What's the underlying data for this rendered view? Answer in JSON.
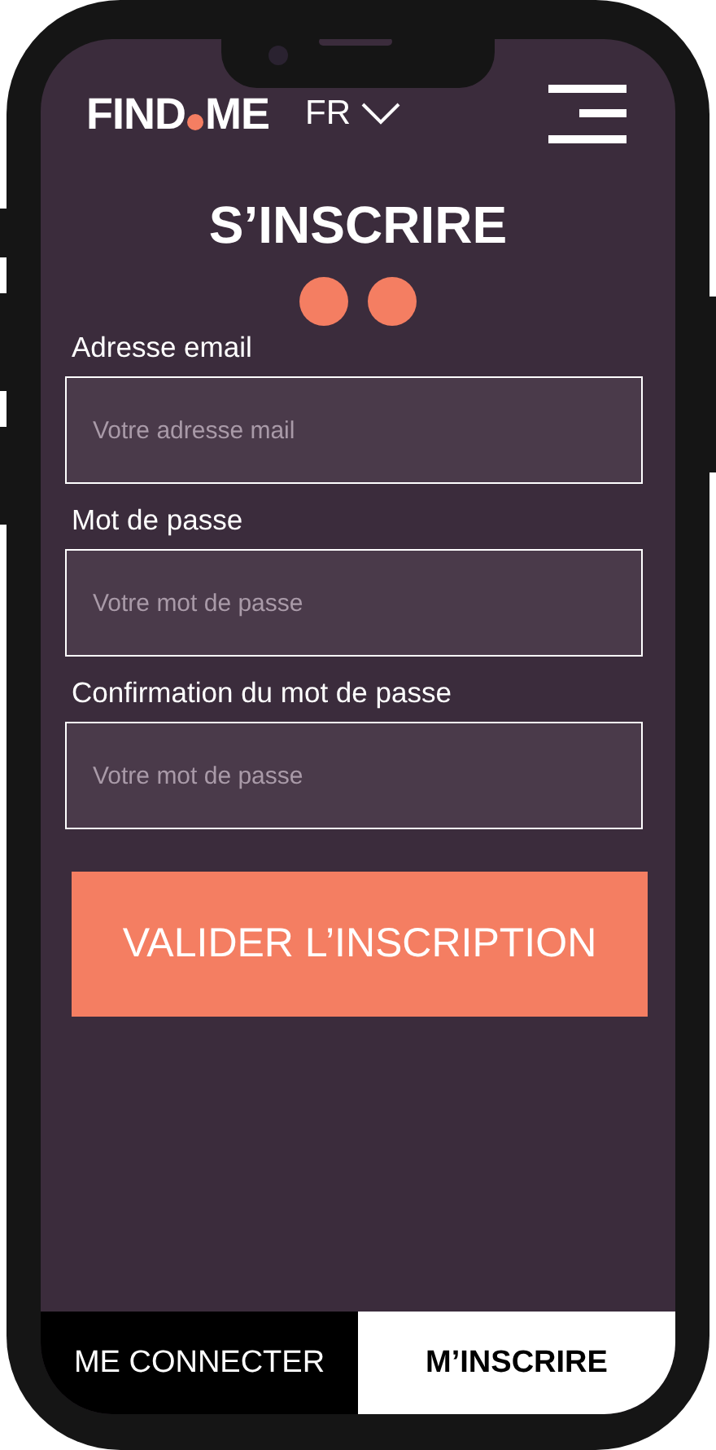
{
  "header": {
    "logo": {
      "left": "FIND",
      "right": "ME"
    },
    "language": "FR"
  },
  "title": "S’INSCRIRE",
  "fields": [
    {
      "label": "Adresse email",
      "placeholder": "Votre adresse mail"
    },
    {
      "label": "Mot de passe",
      "placeholder": "Votre mot de passe"
    },
    {
      "label": "Confirmation du mot de passe",
      "placeholder": "Votre mot de passe"
    }
  ],
  "submit": "VALIDER L’INSCRIPTION",
  "tabs": [
    {
      "label": "ME CONNECTER",
      "selected": false
    },
    {
      "label": "M’INSCRIRE",
      "selected": true
    }
  ]
}
